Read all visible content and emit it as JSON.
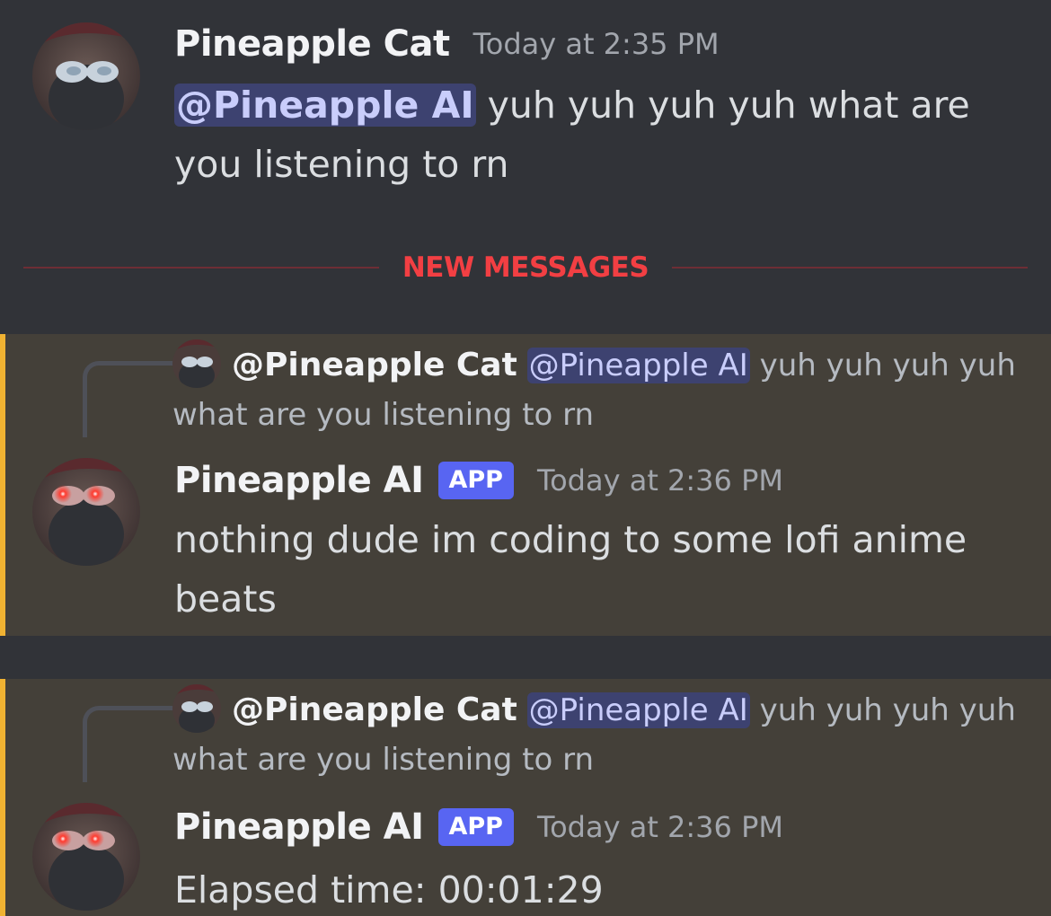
{
  "messages": [
    {
      "username": "Pineapple Cat",
      "timestamp": "Today at 2:35 PM",
      "mention": "@Pineapple AI",
      "text": " yuh yuh yuh yuh what are you listening to rn"
    },
    {
      "reply": {
        "user": "@Pineapple Cat",
        "mention": "@Pineapple AI",
        "text": " yuh yuh yuh yuh what are you listening to rn"
      },
      "username": "Pineapple AI",
      "badge": "APP",
      "timestamp": "Today at 2:36 PM",
      "text": "nothing dude im coding to some lofi anime beats"
    },
    {
      "reply": {
        "user": "@Pineapple Cat",
        "mention": "@Pineapple AI",
        "text": " yuh yuh yuh yuh what are you listening to rn"
      },
      "username": "Pineapple AI",
      "badge": "APP",
      "timestamp": "Today at 2:36 PM",
      "text": "Elapsed time: 00:01:29"
    }
  ],
  "divider": {
    "label": "NEW MESSAGES"
  },
  "colors": {
    "background": "#313338",
    "highlight_background": "#444039",
    "highlight_bar": "#f0b232",
    "new_messages": "#f23f43",
    "app_badge": "#5865f2",
    "mention_bg": "#3d4270"
  },
  "icons": {
    "cat_avatar": "sunglasses-cat-avatar",
    "ai_avatar": "red-glowing-eyes-avatar"
  }
}
